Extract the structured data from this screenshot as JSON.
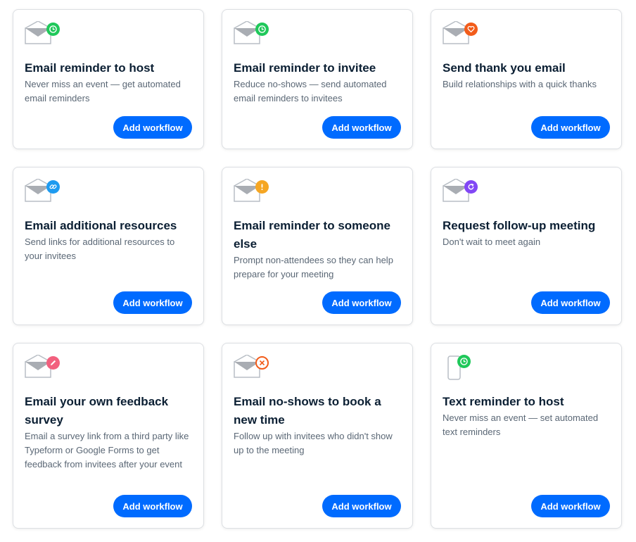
{
  "cards": [
    {
      "title": "Email reminder to host",
      "description": "Never miss an event — get automated email reminders",
      "button": "Add workflow",
      "icon": "envelope-icon",
      "badge_icon": "clock-icon",
      "badge_color": "#1fc85a"
    },
    {
      "title": "Email reminder to invitee",
      "description": "Reduce no-shows — send automated email reminders to invitees",
      "button": "Add workflow",
      "icon": "envelope-icon",
      "badge_icon": "clock-icon",
      "badge_color": "#1fc85a"
    },
    {
      "title": "Send thank you email",
      "description": "Build relationships with a quick thanks",
      "button": "Add workflow",
      "icon": "envelope-icon",
      "badge_icon": "heart-icon",
      "badge_color": "#f25c1a"
    },
    {
      "title": "Email additional resources",
      "description": "Send links for additional resources to your invitees",
      "button": "Add workflow",
      "icon": "envelope-icon",
      "badge_icon": "link-icon",
      "badge_color": "#1e9bf0"
    },
    {
      "title": "Email reminder to someone else",
      "description": "Prompt non-attendees so they can help prepare for your meeting",
      "button": "Add workflow",
      "icon": "envelope-icon",
      "badge_icon": "exclamation-icon",
      "badge_color": "#f5a623"
    },
    {
      "title": "Request follow-up meeting",
      "description": "Don't wait to meet again",
      "button": "Add workflow",
      "icon": "envelope-icon",
      "badge_icon": "refresh-icon",
      "badge_color": "#8247f5"
    },
    {
      "title": "Email your own feedback survey",
      "description": "Email a survey link from a third party like Typeform or Google Forms to get feedback from invitees after your event",
      "button": "Add workflow",
      "icon": "envelope-icon",
      "badge_icon": "pencil-icon",
      "badge_color": "#f2607e"
    },
    {
      "title": "Email no-shows to book a new time",
      "description": "Follow up with invitees who didn't show up to the meeting",
      "button": "Add workflow",
      "icon": "envelope-icon",
      "badge_icon": "x-circle-icon",
      "badge_color": "#f25c1a"
    },
    {
      "title": "Text reminder to host",
      "description": "Never miss an event — set automated text reminders",
      "button": "Add workflow",
      "icon": "phone-icon",
      "badge_icon": "clock-icon",
      "badge_color": "#1fc85a"
    }
  ]
}
